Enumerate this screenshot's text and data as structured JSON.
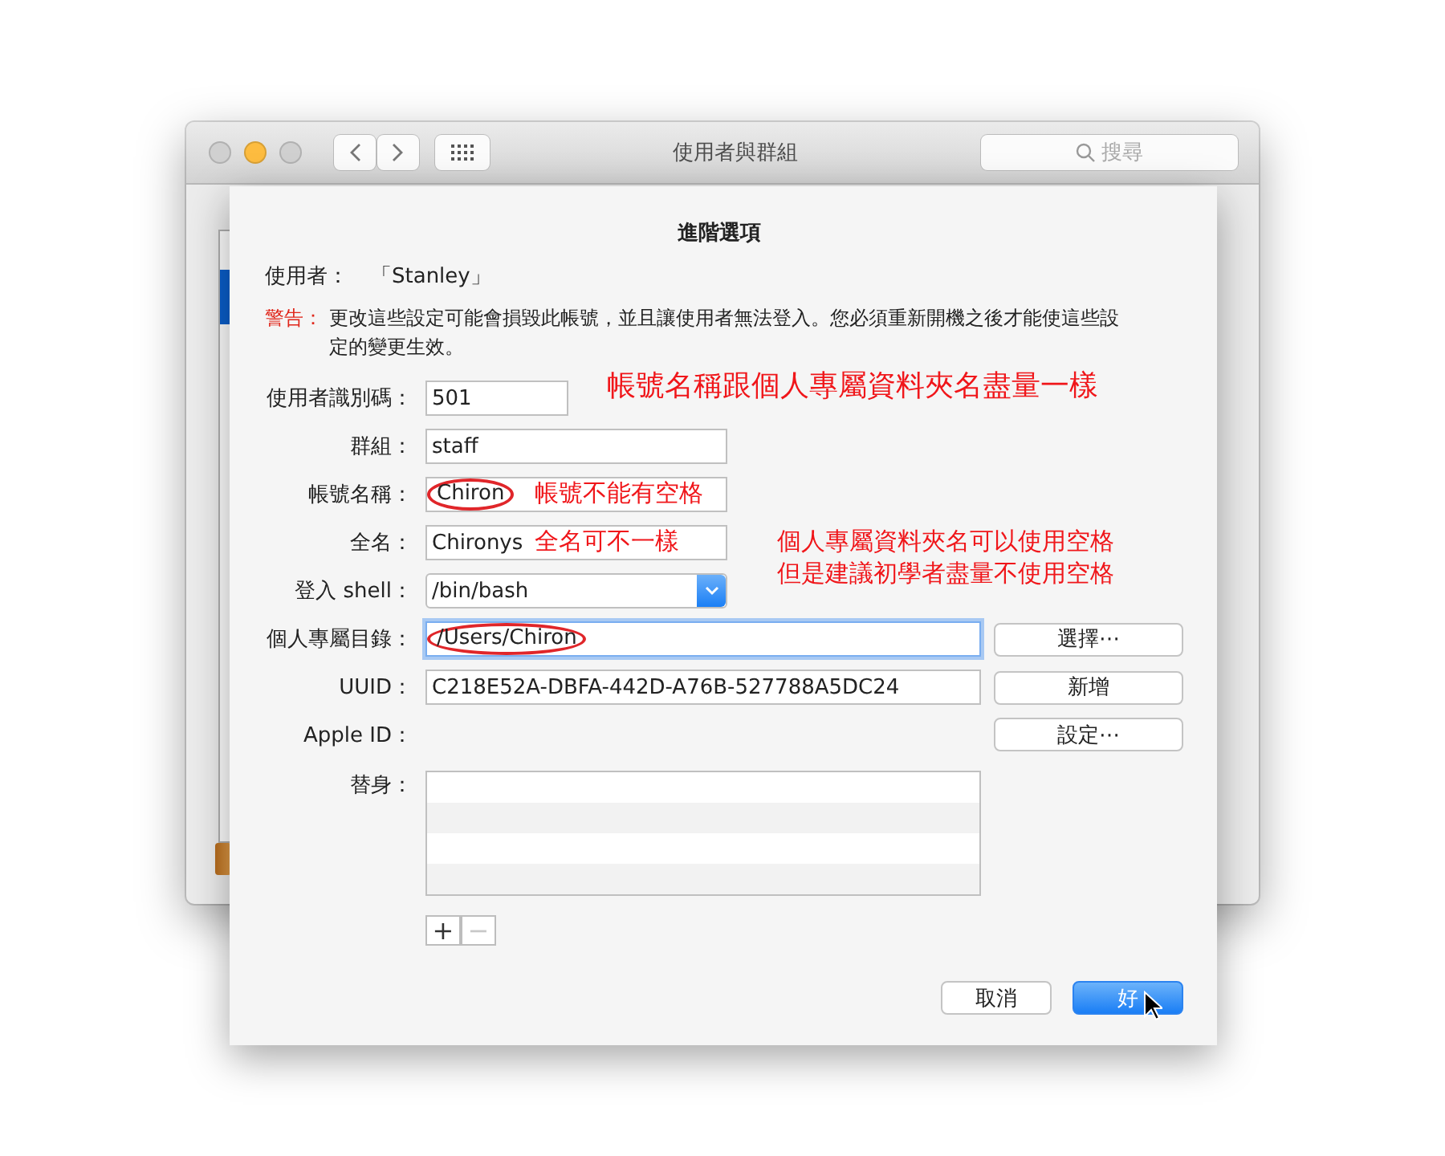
{
  "window": {
    "title": "使用者與群組",
    "search": {
      "placeholder": "搜尋"
    },
    "traffic_lights": [
      {
        "kind": "close",
        "active": false
      },
      {
        "kind": "minimize",
        "active": true
      },
      {
        "kind": "zoom",
        "active": false
      }
    ]
  },
  "sheet": {
    "title": "進階選項",
    "user_label": "使用者：",
    "user_value": "「Stanley」",
    "warning_label": "警告：",
    "warning_text": "更改這些設定可能會損毀此帳號，並且讓使用者無法登入。您必須重新開機之後才能使這些設定的變更生效。",
    "fields": [
      {
        "kind": "short",
        "label": "使用者識別碼：",
        "value": "501",
        "circled": false,
        "focused": false
      },
      {
        "kind": "medium",
        "label": "群組：",
        "value": "staff",
        "circled": false,
        "focused": false
      },
      {
        "kind": "medium",
        "label": "帳號名稱：",
        "value": "Chiron",
        "circled": true,
        "focused": false
      },
      {
        "kind": "medium",
        "label": "全名：",
        "value": "Chironys",
        "circled": false,
        "focused": false
      },
      {
        "kind": "popup",
        "label": "登入 shell：",
        "value": "/bin/bash"
      },
      {
        "kind": "wide",
        "label": "個人專屬目錄：",
        "value": "/Users/Chiron",
        "circled": true,
        "focused": true,
        "button": "選擇⋯"
      },
      {
        "kind": "wide",
        "label": "UUID：",
        "value": "C218E52A-DBFA-442D-A76B-527788A5DC24",
        "circled": false,
        "focused": false,
        "button": "新增"
      },
      {
        "kind": "none",
        "label": "Apple ID：",
        "button": "設定⋯"
      }
    ],
    "alias_label": "替身：",
    "alias_buttons": [
      {
        "text": "+",
        "disabled": false
      },
      {
        "text": "−",
        "disabled": true
      }
    ],
    "buttons": [
      {
        "text": "取消",
        "default": false
      },
      {
        "text": "好",
        "default": true
      }
    ],
    "annotations": [
      {
        "text": "帳號名稱跟個人專屬資料夾名盡量一樣",
        "kind": "headline"
      },
      {
        "text": "帳號不能有空格",
        "kind": "note"
      },
      {
        "text": "全名可不一樣",
        "kind": "note"
      },
      {
        "text": "個人專屬資料夾名可以使用空格",
        "kind": "note"
      },
      {
        "text": "但是建議初學者盡量不使用空格",
        "kind": "note"
      }
    ]
  }
}
